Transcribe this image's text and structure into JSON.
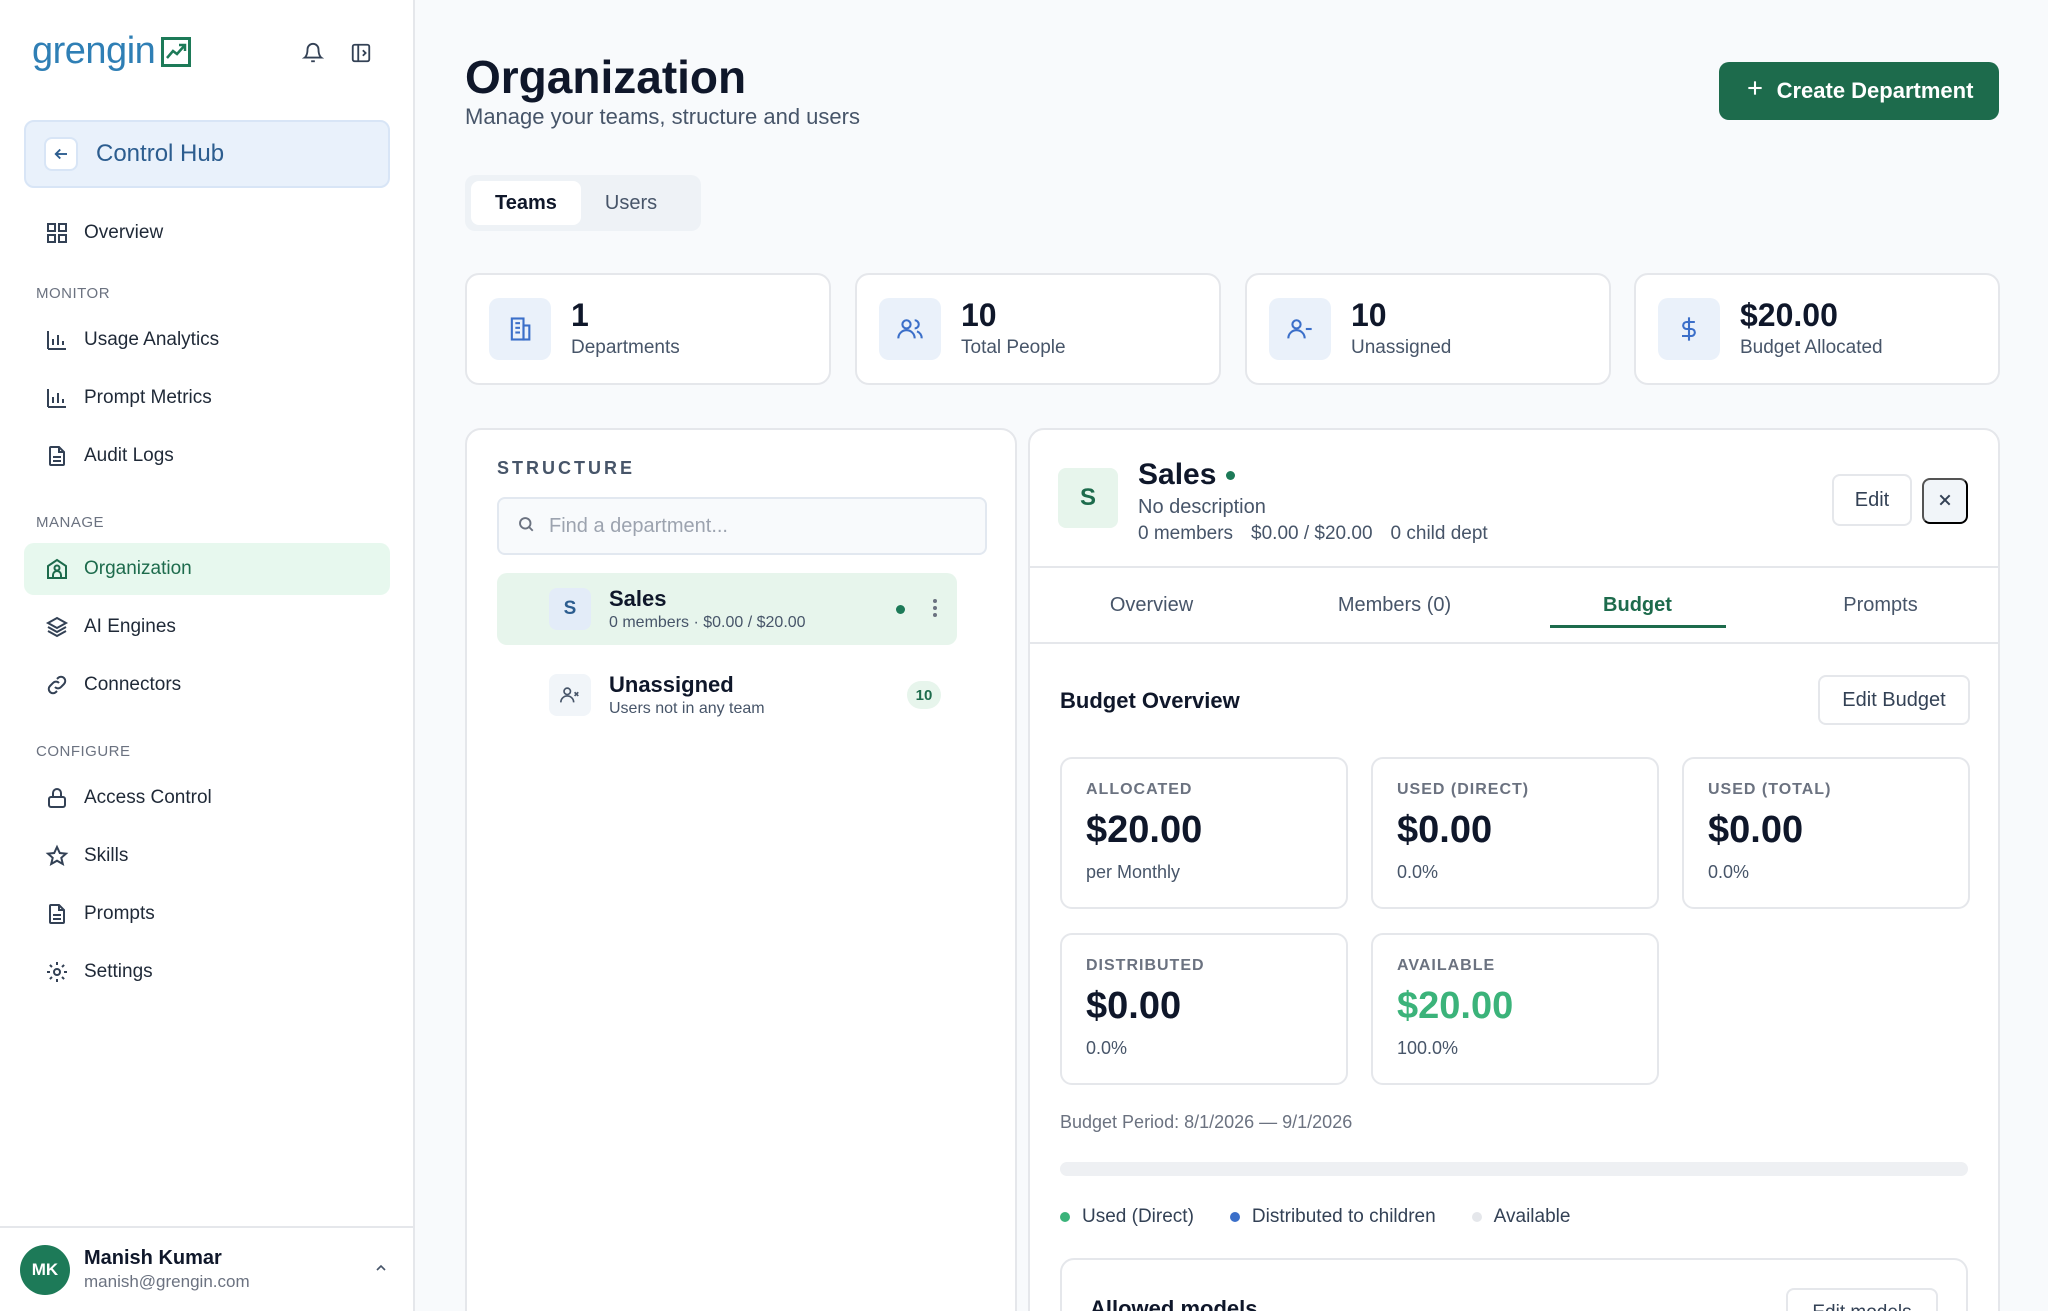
{
  "sidebar": {
    "logo_text": "grengin",
    "hub_label": "Control Hub",
    "overview": "Overview",
    "sections": {
      "monitor": "MONITOR",
      "manage": "MANAGE",
      "configure": "CONFIGURE"
    },
    "items": {
      "usage_analytics": "Usage Analytics",
      "prompt_metrics": "Prompt Metrics",
      "audit_logs": "Audit Logs",
      "organization": "Organization",
      "ai_engines": "AI Engines",
      "connectors": "Connectors",
      "access_control": "Access Control",
      "skills": "Skills",
      "prompts": "Prompts",
      "settings": "Settings"
    },
    "user": {
      "initials": "MK",
      "name": "Manish Kumar",
      "email": "manish@grengin.com"
    }
  },
  "header": {
    "title": "Organization",
    "subtitle": "Manage your teams, structure and users",
    "create_button": "Create Department",
    "tabs": [
      "Teams",
      "Users"
    ]
  },
  "stats": [
    {
      "value": "1",
      "label": "Departments",
      "icon": "building-icon"
    },
    {
      "value": "10",
      "label": "Total People",
      "icon": "users-icon"
    },
    {
      "value": "10",
      "label": "Unassigned",
      "icon": "user-minus-icon"
    },
    {
      "value": "$20.00",
      "label": "Budget Allocated",
      "icon": "dollar-icon"
    }
  ],
  "structure": {
    "label": "STRUCTURE",
    "search_placeholder": "Find a department...",
    "departments": [
      {
        "initial": "S",
        "name": "Sales",
        "meta": "0 members  ·  $0.00 / $20.00"
      },
      {
        "name": "Unassigned",
        "meta": "Users not in any team",
        "count": "10"
      }
    ]
  },
  "detail": {
    "initial": "S",
    "name": "Sales",
    "description": "No description",
    "members": "0 members",
    "budget": "$0.00 / $20.00",
    "child": "0 child dept",
    "edit": "Edit",
    "tabs": [
      "Overview",
      "Members (0)",
      "Budget",
      "Prompts"
    ],
    "active_tab": "Budget",
    "budget_overview": {
      "title": "Budget Overview",
      "edit_button": "Edit Budget",
      "cards": [
        {
          "label": "ALLOCATED",
          "value": "$20.00",
          "sub": "per Monthly"
        },
        {
          "label": "USED (DIRECT)",
          "value": "$0.00",
          "sub": "0.0%"
        },
        {
          "label": "USED (TOTAL)",
          "value": "$0.00",
          "sub": "0.0%"
        },
        {
          "label": "DISTRIBUTED",
          "value": "$0.00",
          "sub": "0.0%"
        },
        {
          "label": "AVAILABLE",
          "value": "$20.00",
          "sub": "100.0%"
        }
      ],
      "period": "Budget Period: 8/1/2026 — 9/1/2026",
      "used_fraction": 0,
      "legend": [
        {
          "label": "Used (Direct)",
          "color": "#3bb37a"
        },
        {
          "label": "Distributed to children",
          "color": "#3b6fc9"
        },
        {
          "label": "Available",
          "color": "#e5e7eb"
        }
      ]
    },
    "models": {
      "title": "Allowed models",
      "edit_button": "Edit models"
    }
  },
  "colors": {
    "brand": "#1d6b4c",
    "accent_blue": "#2f7fb5"
  }
}
